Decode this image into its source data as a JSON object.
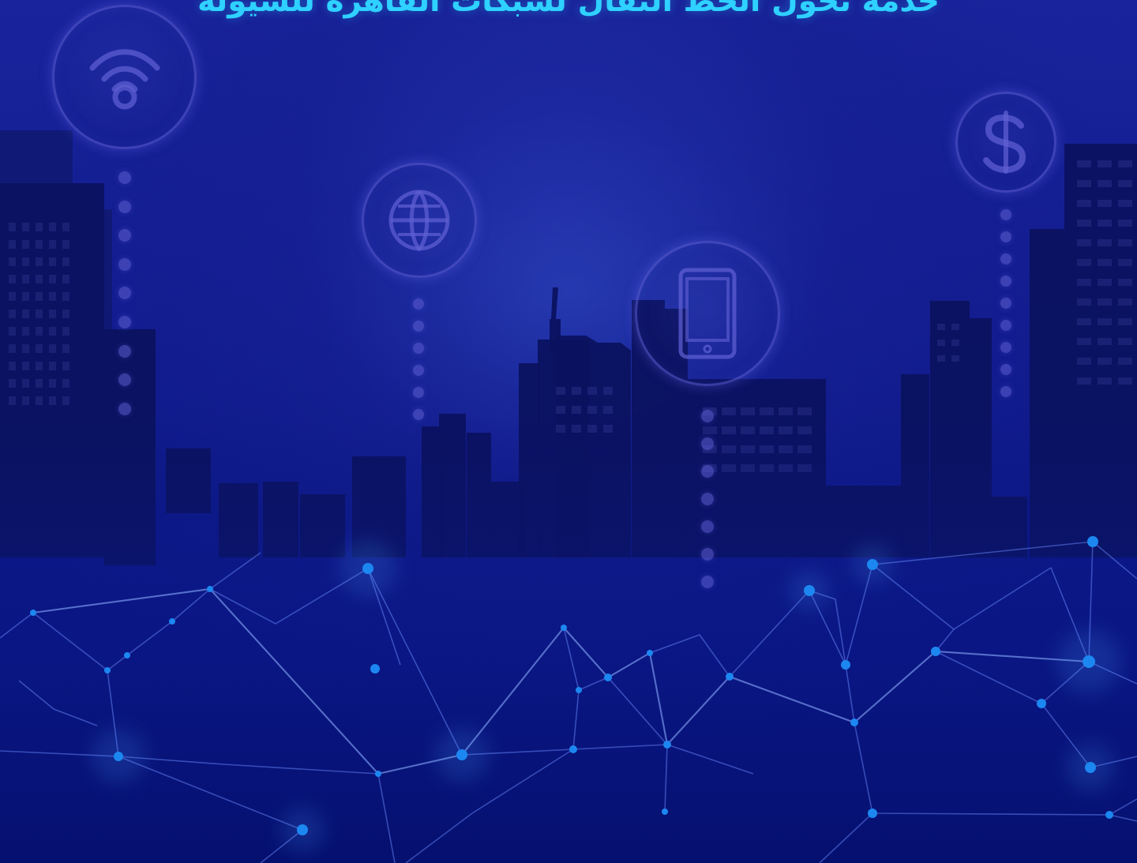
{
  "page": {
    "headline": "خدمة تحول الخط النقال لشبكات القاهرة للسيولة",
    "icons": [
      "wifi-icon",
      "globe-icon",
      "tablet-icon",
      "dollar-icon"
    ]
  }
}
